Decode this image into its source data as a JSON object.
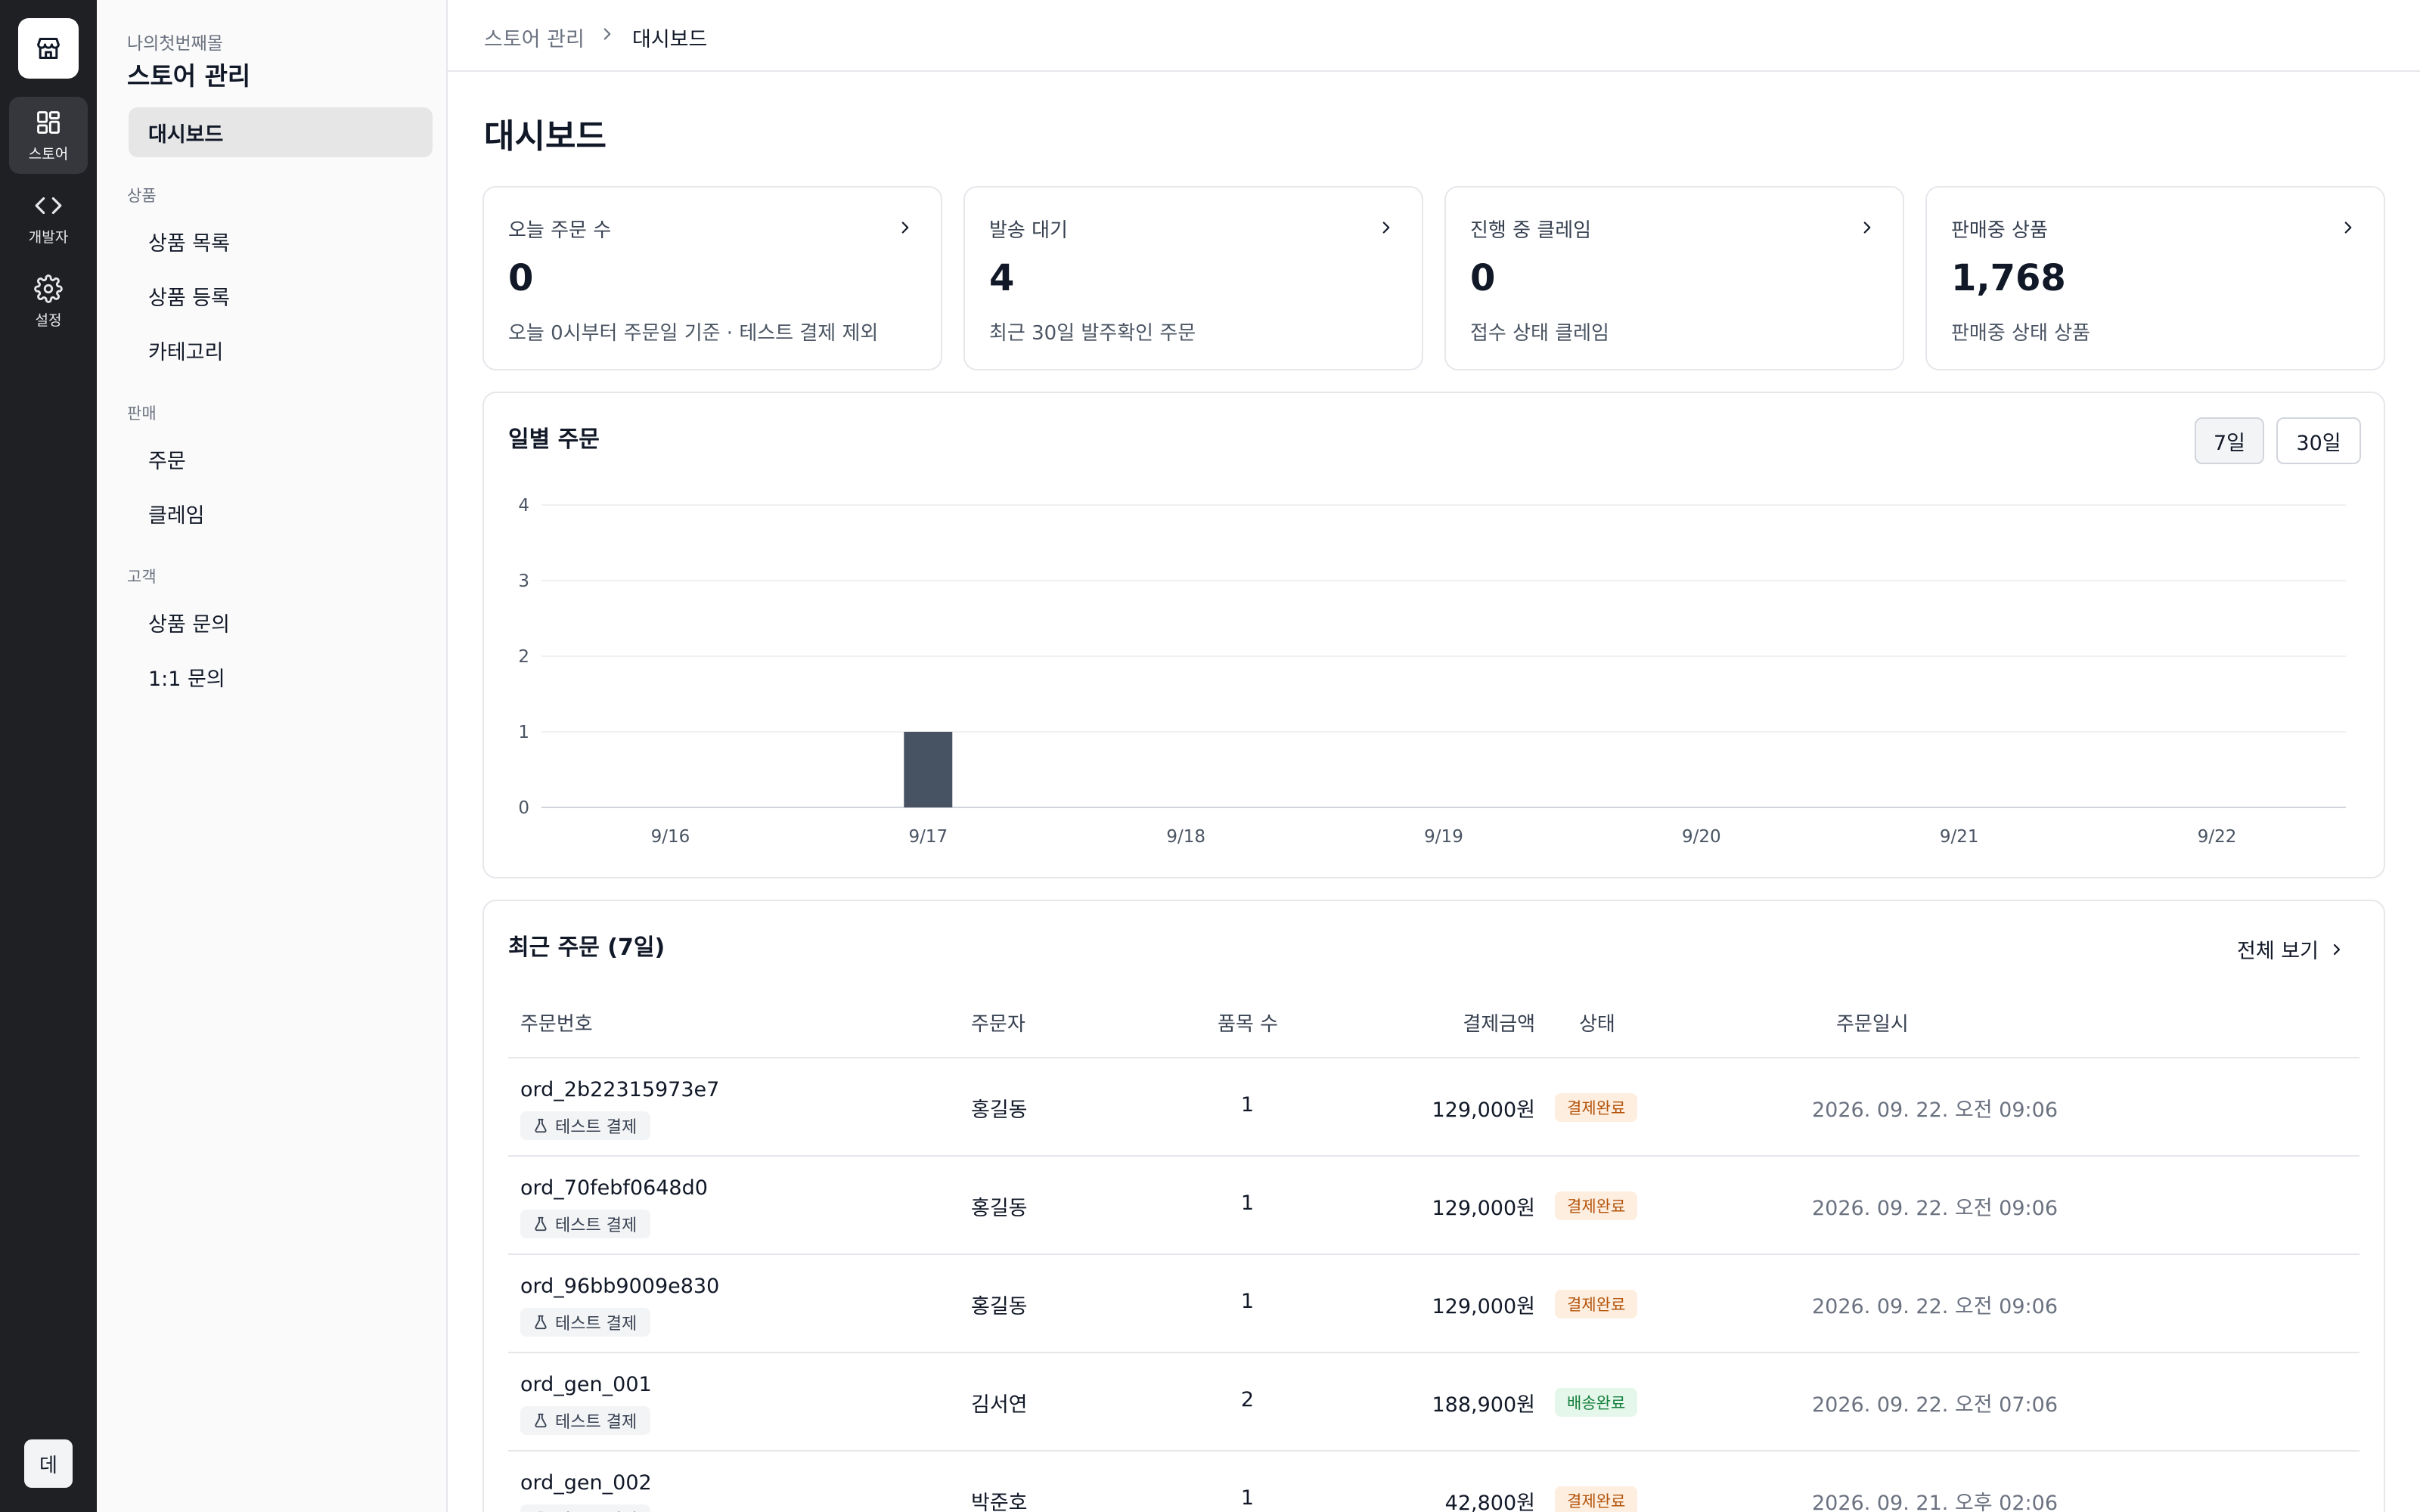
{
  "rail": {
    "items": [
      {
        "label": "스토어",
        "icon": "grid-icon"
      },
      {
        "label": "개발자",
        "icon": "code-icon"
      },
      {
        "label": "설정",
        "icon": "gear-icon"
      }
    ],
    "user_initial": "데"
  },
  "sidebar": {
    "store_sub": "나의첫번째몰",
    "store_name": "스토어 관리",
    "dashboard": "대시보드",
    "sections": [
      {
        "title": "상품",
        "items": [
          "상품 목록",
          "상품 등록",
          "카테고리"
        ]
      },
      {
        "title": "판매",
        "items": [
          "주문",
          "클레임"
        ]
      },
      {
        "title": "고객",
        "items": [
          "상품 문의",
          "1:1 문의"
        ]
      }
    ]
  },
  "breadcrumb": [
    "스토어 관리",
    "대시보드"
  ],
  "page_title": "대시보드",
  "stats": [
    {
      "label": "오늘 주문 수",
      "value": "0",
      "desc": "오늘 0시부터 주문일 기준 · 테스트 결제 제외"
    },
    {
      "label": "발송 대기",
      "value": "4",
      "desc": "최근 30일 발주확인 주문"
    },
    {
      "label": "진행 중 클레임",
      "value": "0",
      "desc": "접수 상태 클레임"
    },
    {
      "label": "판매중 상품",
      "value": "1,768",
      "desc": "판매중 상태 상품"
    }
  ],
  "chart": {
    "title": "일별 주문",
    "ranges": [
      "7일",
      "30일"
    ],
    "active_range": "7일"
  },
  "chart_data": {
    "type": "bar",
    "title": "일별 주문",
    "categories": [
      "9/16",
      "9/17",
      "9/18",
      "9/19",
      "9/20",
      "9/21",
      "9/22"
    ],
    "values": [
      0,
      1,
      0,
      0,
      0,
      0,
      0
    ],
    "ylim": [
      0,
      4
    ],
    "yticks": [
      0,
      1,
      2,
      3,
      4
    ],
    "grid": true,
    "bar_color": "#475263"
  },
  "orders": {
    "title": "최근 주문 (7일)",
    "view_all": "전체 보기",
    "columns": [
      "주문번호",
      "주문자",
      "품목 수",
      "결제금액",
      "상태",
      "주문일시"
    ],
    "test_label": "테스트 결제",
    "rows": [
      {
        "id": "ord_2b22315973e7",
        "buyer": "홍길동",
        "qty": "1",
        "amount": "129,000원",
        "status": "결제완료",
        "date": "2026. 09. 22. 오전 09:06"
      },
      {
        "id": "ord_70febf0648d0",
        "buyer": "홍길동",
        "qty": "1",
        "amount": "129,000원",
        "status": "결제완료",
        "date": "2026. 09. 22. 오전 09:06"
      },
      {
        "id": "ord_96bb9009e830",
        "buyer": "홍길동",
        "qty": "1",
        "amount": "129,000원",
        "status": "결제완료",
        "date": "2026. 09. 22. 오전 09:06"
      },
      {
        "id": "ord_gen_001",
        "buyer": "김서연",
        "qty": "2",
        "amount": "188,900원",
        "status": "배송완료",
        "date": "2026. 09. 22. 오전 07:06"
      },
      {
        "id": "ord_gen_002",
        "buyer": "박준호",
        "qty": "1",
        "amount": "42,800원",
        "status": "결제완료",
        "date": "2026. 09. 21. 오후 02:06"
      }
    ]
  },
  "colors": {
    "rail_bg": "#1f2023",
    "paid_badge_bg": "#fdeee0",
    "paid_badge_text": "#b45309",
    "delivered_badge_bg": "#e5f6ea",
    "delivered_badge_text": "#15803d"
  }
}
